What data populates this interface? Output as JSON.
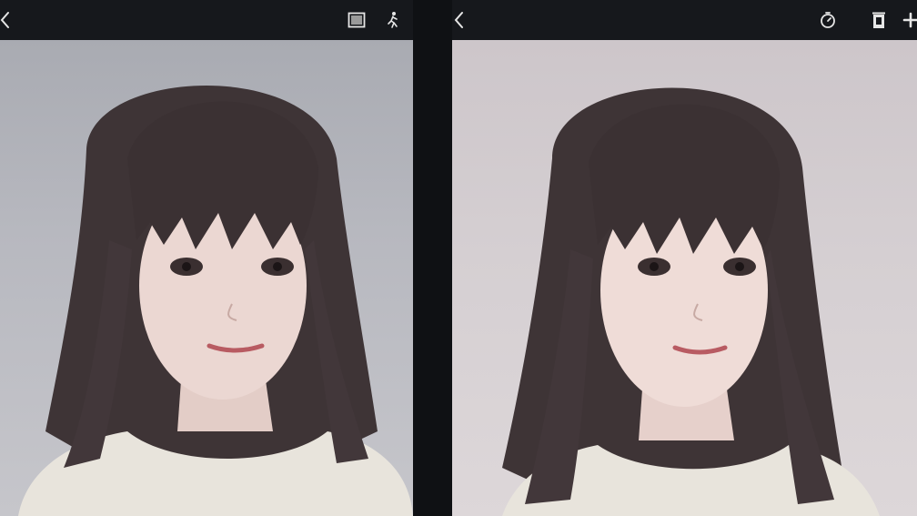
{
  "left_view": {
    "toolbar": {
      "icons": [
        "back-chevron-icon",
        "frame-icon",
        "person-walking-icon"
      ]
    },
    "photo": {
      "subject": "portrait-photo",
      "background_color": "#b3b4bb"
    }
  },
  "right_view": {
    "toolbar": {
      "icons": [
        "back-chevron-icon",
        "timer-icon",
        "delete-icon",
        "add-icon"
      ]
    },
    "photo": {
      "subject": "portrait-photo",
      "background_color": "#d3cdd0"
    }
  },
  "colors": {
    "toolbar": "#16181c",
    "divider": "#0f1114",
    "icon": "#e6e6e6",
    "hair": "#3e3436",
    "skin": "#ebd7d2",
    "sweater": "#e8e4dc"
  }
}
